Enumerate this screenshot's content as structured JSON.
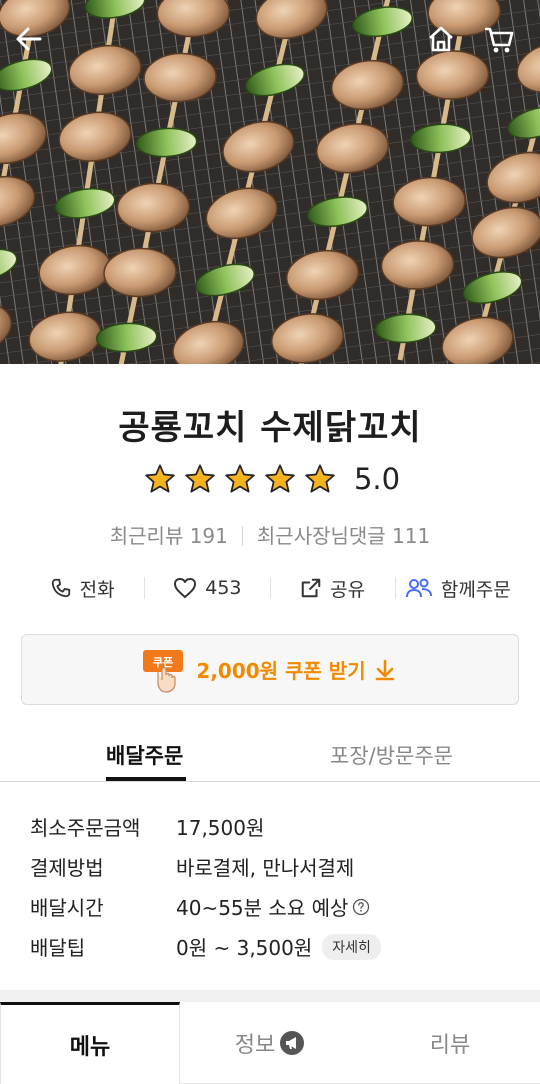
{
  "header": {
    "back_icon": "arrow-left-icon",
    "home_icon": "home-icon",
    "cart_icon": "cart-icon"
  },
  "store": {
    "name": "공룡꼬치 수제닭꼬치",
    "rating": "5.0",
    "stars": 5,
    "recent_reviews": "최근리뷰 191",
    "owner_replies": "최근사장님댓글 111"
  },
  "actions": {
    "call": "전화",
    "likes": "453",
    "share": "공유",
    "group_order": "함께주문"
  },
  "coupon": {
    "badge": "쿠폰",
    "label": "2,000원 쿠폰 받기"
  },
  "order_tabs": {
    "delivery": "배달주문",
    "takeout": "포장/방문주문"
  },
  "info": {
    "min_order_label": "최소주문금액",
    "min_order_value": "17,500원",
    "payment_label": "결제방법",
    "payment_value": "바로결제, 만나서결제",
    "time_label": "배달시간",
    "time_value": "40~55분 소요 예상",
    "tip_label": "배달팁",
    "tip_value": "0원 ~ 3,500원",
    "tip_detail": "자세히"
  },
  "bottom_tabs": {
    "menu": "메뉴",
    "info": "정보",
    "review": "리뷰"
  },
  "colors": {
    "accent": "#f28a00",
    "star": "#f5b321",
    "group_icon": "#4a6cf7"
  }
}
